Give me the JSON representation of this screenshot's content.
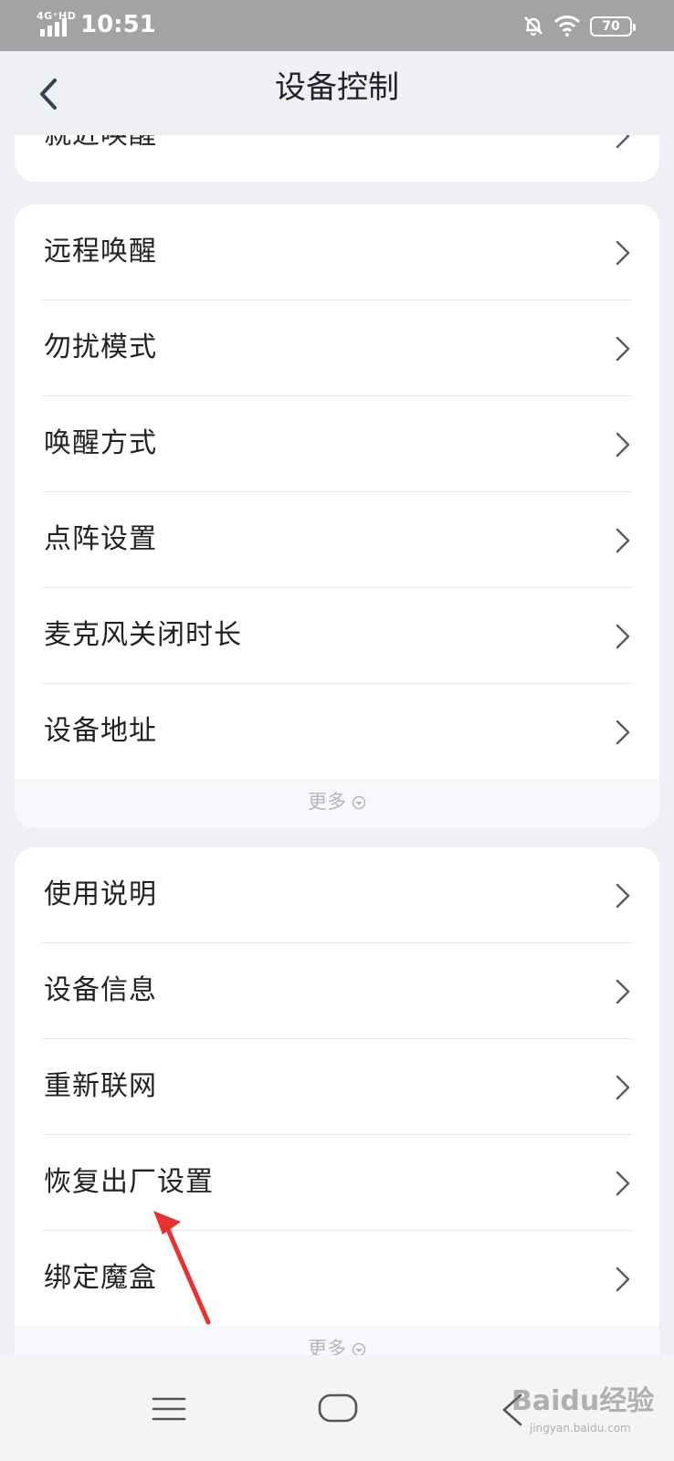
{
  "status_bar": {
    "network": "4G⁺HD",
    "time": "10:51",
    "battery": "70"
  },
  "header": {
    "title": "设备控制"
  },
  "card1": {
    "items": [
      {
        "label": "就近唤醒"
      }
    ]
  },
  "card2": {
    "items": [
      {
        "label": "远程唤醒"
      },
      {
        "label": "勿扰模式"
      },
      {
        "label": "唤醒方式"
      },
      {
        "label": "点阵设置"
      },
      {
        "label": "麦克风关闭时长"
      },
      {
        "label": "设备地址"
      }
    ],
    "more_label": "更多"
  },
  "card3": {
    "items": [
      {
        "label": "使用说明"
      },
      {
        "label": "设备信息"
      },
      {
        "label": "重新联网"
      },
      {
        "label": "恢复出厂设置"
      },
      {
        "label": "绑定魔盒"
      }
    ],
    "more_label": "更多"
  },
  "watermark": {
    "text": "Baidu经验",
    "subtext": "jingyan.baidu.com"
  },
  "colors": {
    "status_bar": "#a3a3a6",
    "background": "#eef0f5",
    "card": "#ffffff",
    "annotation_arrow": "#e8322e"
  }
}
